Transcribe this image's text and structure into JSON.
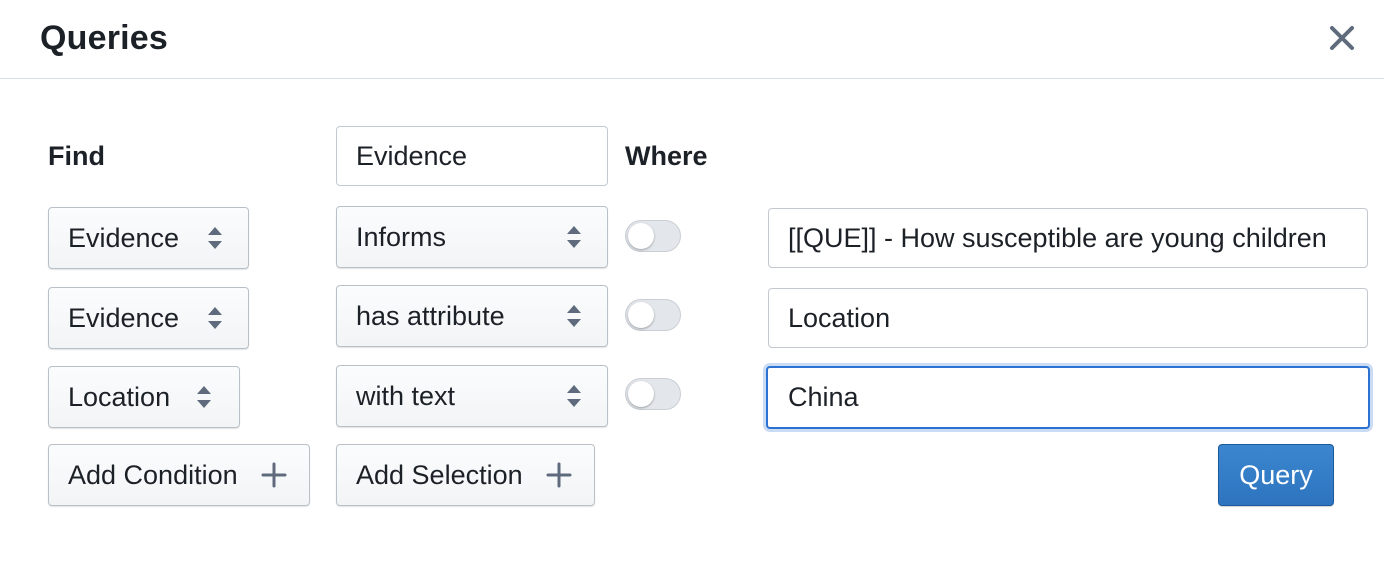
{
  "dialog": {
    "title": "Queries",
    "close_icon": "close-icon"
  },
  "find": {
    "label": "Find",
    "value": "Evidence"
  },
  "where_label": "Where",
  "conditions": [
    {
      "source": "Evidence",
      "relation": "Informs",
      "negate": false,
      "target": "[[QUE]] - How susceptible are young children"
    },
    {
      "source": "Evidence",
      "relation": "has attribute",
      "negate": false,
      "target": "Location"
    },
    {
      "source": "Location",
      "relation": "with text",
      "negate": false,
      "target": "China"
    }
  ],
  "actions": {
    "add_condition": "Add Condition",
    "add_selection": "Add Selection",
    "query": "Query"
  },
  "colors": {
    "primary": "#2e74bf",
    "focus": "#2d72d2"
  }
}
